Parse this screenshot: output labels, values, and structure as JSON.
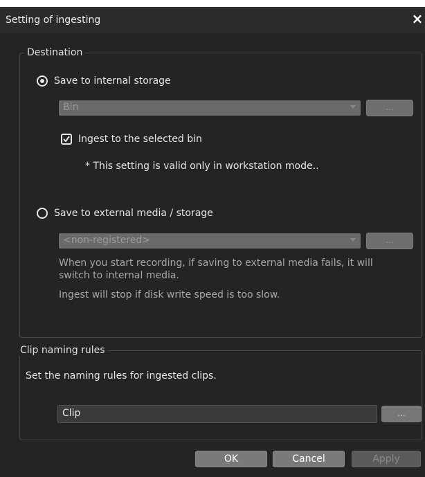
{
  "window": {
    "title": "Setting of ingesting",
    "close_label": "×"
  },
  "destination": {
    "legend": "Destination",
    "internal": {
      "label": "Save to internal storage",
      "selected": true,
      "bin_select": {
        "value": "Bin"
      },
      "browse_label": "...",
      "ingest_checkbox": {
        "label": "Ingest to the selected bin",
        "checked": true
      },
      "note": "* This setting is valid only in workstation mode.."
    },
    "external": {
      "label": "Save to external media / storage",
      "selected": false,
      "media_select": {
        "value": "<non-registered>"
      },
      "browse_label": "...",
      "info_line1": "When you start recording, if saving to external media fails, it will",
      "info_line2": "switch to internal media.",
      "info_line3": "Ingest will stop if disk write speed is too slow."
    }
  },
  "clip_naming": {
    "legend": "Clip naming rules",
    "description": "Set the naming rules for ingested clips.",
    "input_value": "Clip",
    "browse_label": "..."
  },
  "footer": {
    "ok_label": "OK",
    "cancel_label": "Cancel",
    "apply_label": "Apply"
  },
  "colors": {
    "window_bg": "#242424",
    "button_bg": "#7a7a7a",
    "disabled_bg": "#5a5a5a"
  }
}
